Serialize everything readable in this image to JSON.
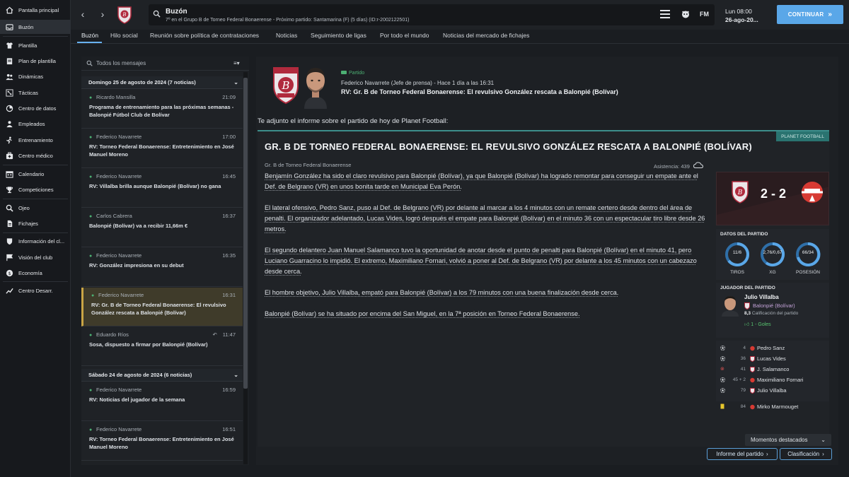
{
  "sidebar": {
    "items": [
      {
        "label": "Pantalla principal",
        "icon": "home-icon"
      },
      {
        "label": "Buzón",
        "icon": "inbox-icon"
      },
      {
        "label": "Plantilla",
        "icon": "shirt-icon"
      },
      {
        "label": "Plan de plantilla",
        "icon": "clipboard-icon"
      },
      {
        "label": "Dinámicas",
        "icon": "people-icon"
      },
      {
        "label": "Tácticas",
        "icon": "tactics-icon"
      },
      {
        "label": "Centro de datos",
        "icon": "data-icon"
      },
      {
        "label": "Empleados",
        "icon": "staff-icon"
      },
      {
        "label": "Entrenamiento",
        "icon": "training-icon"
      },
      {
        "label": "Centro médico",
        "icon": "medical-icon"
      },
      {
        "label": "Calendario",
        "icon": "calendar-icon"
      },
      {
        "label": "Competiciones",
        "icon": "trophy-icon"
      },
      {
        "label": "Ojeo",
        "icon": "scout-icon"
      },
      {
        "label": "Fichajes",
        "icon": "transfer-icon"
      },
      {
        "label": "Información del cl...",
        "icon": "club-info-icon"
      },
      {
        "label": "Visión del club",
        "icon": "vision-icon"
      },
      {
        "label": "Economía",
        "icon": "finance-icon"
      },
      {
        "label": "Centro Desarr.",
        "icon": "development-icon"
      }
    ]
  },
  "topbar": {
    "title": "Buzón",
    "subtitle": "7º en el Grupo B de Torneo Federal Bonaerense - Próximo partido: Santamarina (F) (5 días) (ID:r-2002122501)",
    "fm_label": "FM",
    "day": "Lun 08:00",
    "date": "26-ago-20...",
    "continue_label": "CONTINUAR"
  },
  "tabs": [
    "Buzón",
    "Hilo social",
    "Reunión sobre política de contrataciones",
    "Noticias",
    "Seguimiento de ligas",
    "Por todo el mundo",
    "Noticias del mercado de fichajes"
  ],
  "inbox": {
    "search_placeholder": "Todos los mensajes",
    "day1": "Domingo 25 de agosto de 2024 (7 noticias)",
    "day2": "Sábado 24 de agosto de 2024 (6 noticias)",
    "messages1": [
      {
        "from": "Ricardo Mansilla",
        "time": "21:09",
        "subject": "Programa de entrenamiento para las próximas semanas - Balonpié Fútbol Club de Bolívar"
      },
      {
        "from": "Federico Navarrete",
        "time": "17:00",
        "subject": "RV: Torneo Federal Bonaerense: Entretenimiento en José Manuel Moreno"
      },
      {
        "from": "Federico Navarrete",
        "time": "16:45",
        "subject": "RV: Villalba brilla aunque Balonpié (Bolívar) no gana"
      },
      {
        "from": "Carlos Cabrera",
        "time": "16:37",
        "subject": "Balonpié (Bolívar) va a recibir 11,66m €"
      },
      {
        "from": "Federico Navarrete",
        "time": "16:35",
        "subject": "RV: González impresiona en su debut"
      },
      {
        "from": "Federico Navarrete",
        "time": "16:31",
        "subject": "RV: Gr. B de Torneo Federal Bonaerense: El revulsivo González rescata a Balonpié (Bolívar)"
      },
      {
        "from": "Eduardo Ríos",
        "time": "11:47",
        "subject": "Sosa, dispuesto a firmar por Balonpié (Bolívar)"
      }
    ],
    "messages2": [
      {
        "from": "Federico Navarrete",
        "time": "16:59",
        "subject": "RV: Noticias del jugador de la semana"
      },
      {
        "from": "Federico Navarrete",
        "time": "16:51",
        "subject": "RV: Torneo Federal Bonaerense: Entretenimiento en José Manuel Moreno"
      }
    ]
  },
  "message": {
    "tag": "Partido",
    "from": "Federico Navarrete  (Jefe de prensa)  -  Hace 1 día a las 16:31",
    "subject": "RV: Gr. B de Torneo Federal Bonaerense: El revulsivo González rescata a Balonpié (Bolívar)",
    "intro": "Te adjunto el informe sobre el partido de hoy de Planet Football:"
  },
  "article": {
    "badge": "PLANET FOOTBALL",
    "title": "GR. B DE TORNEO FEDERAL BONAERENSE: EL REVULSIVO GONZÁLEZ RESCATA A BALONPIÉ (BOLÍVAR)",
    "competition": "Gr. B de Torneo Federal Bonaerense",
    "attendance": "Asistencia: 439",
    "p1": "Benjamín González ha sido el claro revulsivo para Balonpié (Bolívar), ya que Balonpié (Bolívar) ha logrado remontar para conseguir un empate ante el Def. de Belgrano (VR) en unos bonita tarde en Municipal Eva Perón.",
    "p2": "El lateral ofensivo, Pedro Sanz, puso al Def. de Belgrano (VR) por delante al marcar a los 4 minutos con un remate certero desde dentro del área de penalti. El organizador adelantado, Lucas Vides, logró después el empate para Balonpié (Bolívar) en el minuto 36 con un espectacular tiro libre desde 26 metros.",
    "p3": "El segundo delantero Juan Manuel Salamanco tuvo la oportunidad de anotar desde el punto de penalti para Balonpié (Bolívar) en el minuto 41, pero Luciano Guarracino lo impidió. El extremo, Maximiliano Fornari, volvió a poner al Def. de Belgrano (VR) por delante a los 45 minutos con un cabezazo desde cerca.",
    "p4": "El hombre objetivo, Julio Villalba, empató para Balonpié (Bolívar) a los 79 minutos con una buena finalización desde cerca.",
    "p5": "Balonpié (Bolívar) se ha situado por encima del San Miguel, en la 7ª posición en Torneo Federal Bonaerense."
  },
  "match": {
    "score": "2 - 2",
    "stats_title": "DATOS DEL PARTIDO",
    "stats": [
      {
        "label": "TIROS",
        "value": "11/6"
      },
      {
        "label": "XG",
        "value": "2,76/0,67"
      },
      {
        "label": "POSESIÓN",
        "value": "66/34"
      }
    ],
    "motm_title": "JUGADOR DEL PARTIDO",
    "motm_name": "Julio Villalba",
    "motm_club": "Balonpié (Bolívar)",
    "motm_rating": "8,3",
    "motm_rating_label": "Calificación del partido",
    "motm_goals": "1 - Goles",
    "events": [
      {
        "min": "4",
        "name": "Pedro Sanz"
      },
      {
        "min": "36",
        "name": "Lucas Vides"
      },
      {
        "min": "41",
        "name": "J. Salamanco"
      },
      {
        "min": "45 + 2",
        "name": "Maximiliano Fornari"
      },
      {
        "min": "79",
        "name": "Julio Villalba"
      },
      {
        "min": "84",
        "name": "Mirko Marmouget"
      }
    ]
  },
  "buttons": {
    "highlights": "Momentos destacados",
    "match_report": "Informe del partido",
    "table": "Clasificación"
  },
  "colors": {
    "accent": "#5aa7e8",
    "selected": "#3f3b2a",
    "green": "#4caf73"
  }
}
